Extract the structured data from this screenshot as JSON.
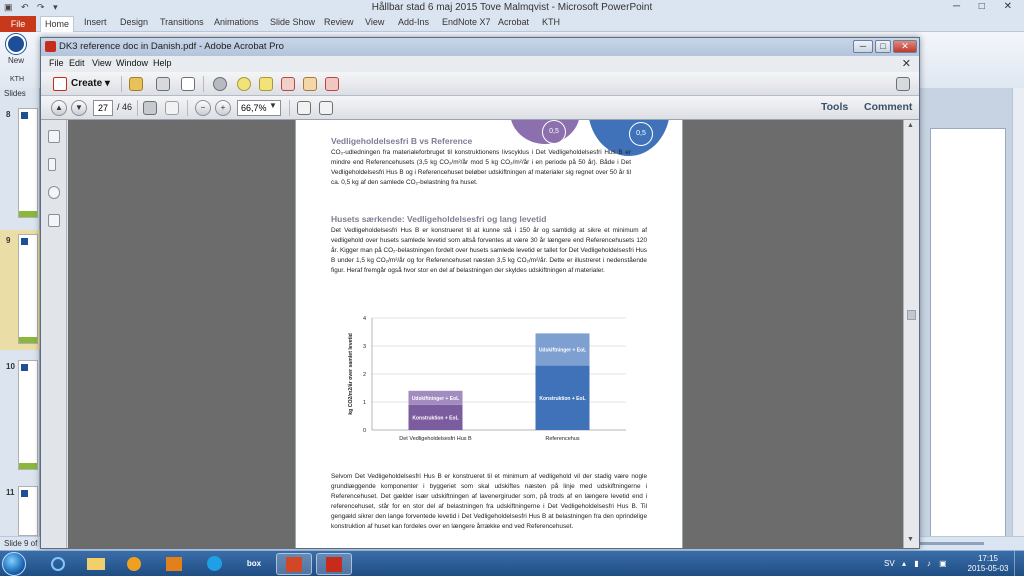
{
  "ppt": {
    "title": "Hållbar stad 6 maj 2015 Tove Malmqvist  -  Microsoft PowerPoint",
    "file_tab": "File",
    "tabs": [
      "Home",
      "Insert",
      "Design",
      "Transitions",
      "Animations",
      "Slide Show",
      "Review",
      "View",
      "Add-Ins",
      "EndNote X7",
      "Acrobat",
      "KTH"
    ],
    "new_label": "New",
    "kth_label": "KTH",
    "slides_label": "Slides",
    "slide_numbers": [
      "8",
      "9",
      "10",
      "11"
    ],
    "status_text": "Slide 9 of"
  },
  "acrobat": {
    "title": "DK3 reference doc in Danish.pdf - Adobe Acrobat Pro",
    "menu": [
      "File",
      "Edit",
      "View",
      "Window",
      "Help"
    ],
    "create_label": "Create",
    "page_current": "27",
    "page_total": "/ 46",
    "zoom": "66,7%",
    "tools_label": "Tools",
    "comment_label": "Comment"
  },
  "pdf": {
    "circle_labels": [
      "0,5",
      "0,5"
    ],
    "heading1": "Vedligeholdelsesfri B vs Reference",
    "para1": "CO₂-udledningen fra materialeforbruget til konstruktionens livscyklus i Det Vedligeholdelsesfri Hus B er mindre end Referencehusets (3,5 kg CO₂/m²/år mod 5 kg CO₂/m²/år i en periode på 50 år). Både i Det Vedligeholdelsesfri Hus B og i Referencehuset beløber udskiftningen af materialer sig regnet over 50 år til ca. 0,5 kg af den samlede CO₂-belastning fra huset.",
    "heading2": "Husets særkende: Vedligeholdelsesfri og lang levetid",
    "para2": "Det Vedligeholdelsesfri Hus B er konstrueret til at kunne stå i 150 år og samtidig at sikre et minimum af vedligehold over husets samlede levetid som altså forventes at være 30 år længere end Referencehusets 120 år. Kigger man på CO₂-belastningen fordelt over husets samlede levetid er tallet for Det Vedligeholdelsesfri Hus B under 1,5 kg CO₂/m²/år og for Referencehuset næsten 3,5 kg CO₂/m²/år. Dette er illustreret i nedenstående figur. Heraf fremgår også hvor stor en del af belastningen der skyldes udskiftningen af materialer.",
    "para3": "Selvom Det Vedligeholdelsesfri Hus B er konstrueret til et minimum af vedligehold vil der stadig være nogle grundlæggende komponenter i byggeriet som skal udskiftes næsten på linje med udskiftningerne i Referencehuset. Det gælder især udskiftningen af lavenergiruder som, på trods af en længere levetid end i referencehuset, står for en stor del af belastningen fra udskiftningerne i Det Vedligeholdelsesfri Hus B. Til gengæld sikrer den lange forventede levetid i Det Vedligeholdelsesfri Hus B at belastningen fra den oprindelige konstruktion af huset kan fordeles over en længere årrække end ved Referencehuset."
  },
  "chart_data": {
    "type": "bar",
    "stacked": true,
    "categories": [
      "Det Vedligeholdelsesfri Hus B",
      "Referencehus"
    ],
    "series": [
      {
        "name": "Konstruktion + EoL",
        "values": [
          0.9,
          2.3
        ],
        "colors": [
          "#7b5c9e",
          "#3f72b8"
        ]
      },
      {
        "name": "Udskiftninger + EoL",
        "values": [
          0.5,
          1.15
        ],
        "colors": [
          "#a18bbf",
          "#7ea0d1"
        ]
      }
    ],
    "ylabel": "kg CO2/m2/år over samlet levetid",
    "ylim": [
      0,
      4
    ],
    "yticks": [
      "0",
      "1",
      "2",
      "3",
      "4"
    ],
    "grid": true
  },
  "taskbar": {
    "items": [
      "IE",
      "Explorer",
      "Media",
      "Outlook",
      "Skype",
      "box",
      "PowerPoint",
      "Acrobat"
    ],
    "lang": "SV",
    "time": "17:15",
    "date": "2015-05-03"
  }
}
